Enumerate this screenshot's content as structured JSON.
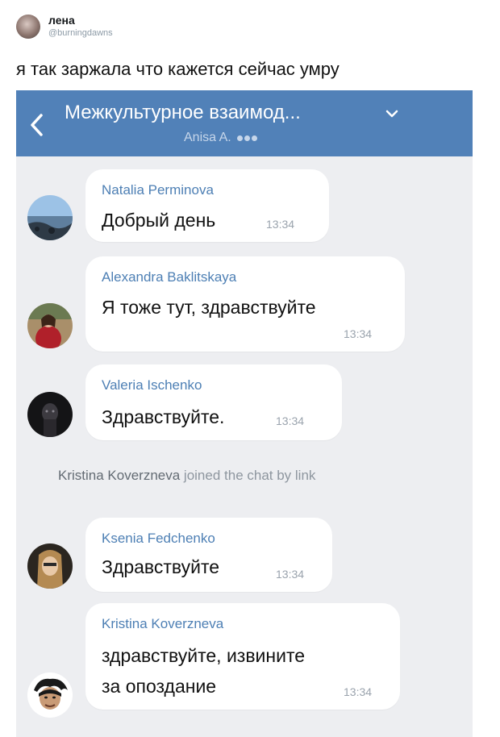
{
  "tweet": {
    "name": "лена",
    "handle": "@burningdawns",
    "text": "я так заржала что кажется сейчас умру"
  },
  "chat": {
    "title": "Межкультурное взаимод...",
    "subtitle": "Anisa A.",
    "header_color": "#5181b8",
    "messages": [
      {
        "sender": "Natalia Perminova",
        "lines": [
          "Добрый день"
        ],
        "time": "13:34"
      },
      {
        "sender": "Alexandra Baklitskaya",
        "lines": [
          "Я тоже тут, здравствуйте"
        ],
        "time": "13:34"
      },
      {
        "sender": "Valeria Ischenko",
        "lines": [
          "Здравствуйте."
        ],
        "time": "13:34"
      },
      {
        "sender": "Ksenia Fedchenko",
        "lines": [
          "Здравствуйте"
        ],
        "time": "13:34"
      },
      {
        "sender": "Kristina Koverzneva",
        "lines": [
          "здравствуйте, извините",
          "за опоздание"
        ],
        "time": "13:34"
      }
    ],
    "system_message": {
      "name": "Kristina Koverzneva",
      "text": "joined the chat by link"
    }
  },
  "icons": [
    "back-chevron-icon",
    "chevron-down-icon",
    "more-dots-icon"
  ]
}
